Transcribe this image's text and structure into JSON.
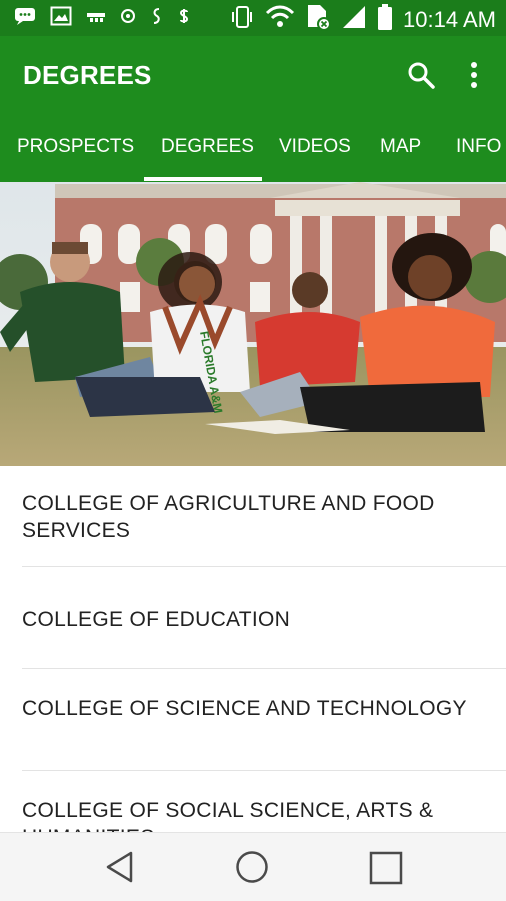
{
  "status_bar": {
    "time": "10:14 AM",
    "left_icons": [
      "message-icon",
      "image-icon",
      "signal-app-icon",
      "circle-app-icon",
      "script-icon",
      "dollar-icon"
    ],
    "right_icons": [
      "vibrate-icon",
      "wifi-icon",
      "sim-icon",
      "cell-signal-icon",
      "battery-icon"
    ]
  },
  "app_bar": {
    "title": "DEGREES",
    "search_icon": "search-icon",
    "more_icon": "more-vert-icon"
  },
  "tabs": [
    {
      "label": "PROSPECTS",
      "selected": false
    },
    {
      "label": "DEGREES",
      "selected": true
    },
    {
      "label": "VIDEOS",
      "selected": false
    },
    {
      "label": "MAP",
      "selected": false
    },
    {
      "label": "INFO",
      "selected": false
    }
  ],
  "hero": {
    "shirt_text": "FLORIDA A&M"
  },
  "colleges": [
    {
      "label": "COLLEGE OF AGRICULTURE AND FOOD SERVICES"
    },
    {
      "label": "COLLEGE OF EDUCATION"
    },
    {
      "label": "COLLEGE OF SCIENCE AND TECHNOLOGY"
    },
    {
      "label": "COLLEGE OF SOCIAL SCIENCE, ARTS & HUMANITIES"
    }
  ],
  "nav_bar": {
    "back_icon": "back-icon",
    "home_icon": "home-icon",
    "recents_icon": "recents-icon"
  },
  "colors": {
    "primary": "#1e8c1e",
    "status_bar": "#1b7d1b",
    "tab_indicator": "#ffffff"
  }
}
